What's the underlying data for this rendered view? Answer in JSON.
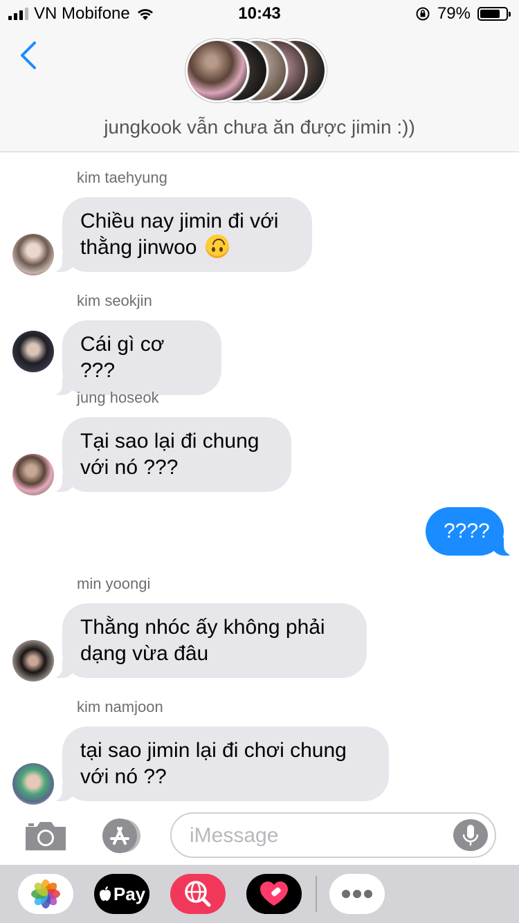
{
  "status_bar": {
    "carrier": "VN Mobifone",
    "time": "10:43",
    "battery": "79%",
    "battery_level": 0.79,
    "signal_bars": 3
  },
  "header": {
    "group_name": "jungkook vẫn chưa ăn được jimin :))"
  },
  "messages": [
    {
      "sender": "kim taehyung",
      "text_lines": [
        "Chiều nay jimin đi với",
        "thằng jinwoo"
      ],
      "emoji": "upside-down-face",
      "direction": "incoming"
    },
    {
      "sender": "kim seokjin",
      "text_lines": [
        "Cái gì cơ ???"
      ],
      "direction": "incoming"
    },
    {
      "sender": "jung hoseok",
      "text_lines": [
        "Tại sao lại đi chung",
        "với nó ???"
      ],
      "direction": "incoming"
    },
    {
      "text_lines": [
        "????"
      ],
      "direction": "outgoing"
    },
    {
      "sender": "min yoongi",
      "text_lines": [
        "Thằng nhóc ấy không phải",
        "dạng vừa đâu"
      ],
      "direction": "incoming"
    },
    {
      "sender": "kim namjoon",
      "text_lines": [
        "tại sao jimin lại đi chơi chung",
        "với nó ??"
      ],
      "direction": "incoming"
    }
  ],
  "composer": {
    "placeholder": "iMessage",
    "value": ""
  },
  "app_drawer": [
    {
      "name": "Photos",
      "icon": "photos-icon"
    },
    {
      "name": "Apple Pay",
      "label": "Pay",
      "icon": "apple-pay-icon"
    },
    {
      "name": "Images search",
      "icon": "globe-search-icon"
    },
    {
      "name": "Digital Touch",
      "icon": "heart-icon"
    },
    {
      "name": "More",
      "icon": "more-icon"
    }
  ],
  "colors": {
    "accent": "#1a8cff",
    "incoming_bubble": "#e6e6eb",
    "header_bg": "#f7f7f7",
    "drawer_bg": "#d3d3d8"
  }
}
